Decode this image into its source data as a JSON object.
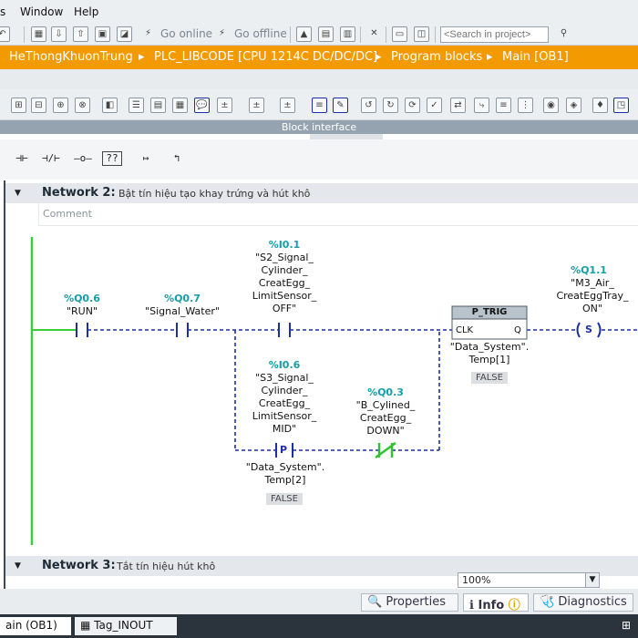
{
  "menu": {
    "items": [
      "s",
      "Window",
      "Help"
    ]
  },
  "toolbar": {
    "go_online": "Go online",
    "go_offline": "Go offline",
    "search_placeholder": "<Search in project>"
  },
  "breadcrumb": [
    "HeThongKhuonTrung",
    "PLC_LIBCODE [CPU 1214C DC/DC/DC]",
    "Program blocks",
    "Main [OB1]"
  ],
  "block_interface": {
    "title": "Block interface"
  },
  "favorites": [
    {
      "icon": "normally-open-contact-icon",
      "glyph": "⊣⊢"
    },
    {
      "icon": "normally-closed-contact-icon",
      "glyph": "⊣/⊢"
    },
    {
      "icon": "coil-icon",
      "glyph": "–o–"
    },
    {
      "icon": "empty-box-icon",
      "glyph": "??"
    },
    {
      "icon": "open-branch-icon",
      "glyph": "↦"
    },
    {
      "icon": "close-branch-icon",
      "glyph": "↰"
    }
  ],
  "network2": {
    "label": "Network 2:",
    "title": "Bật tín hiệu tạo khay trứng và hút khô",
    "comment": "Comment",
    "run": {
      "address": "%Q0.6",
      "tag": "\"RUN\""
    },
    "signal_water": {
      "address": "%Q0.7",
      "tag": "\"Signal_Water\""
    },
    "s2": {
      "address": "%I0.1",
      "tag": [
        "\"S2_Signal_",
        "Cylinder_",
        "CreatEgg_",
        "LimitSensor_",
        "OFF\""
      ]
    },
    "s3": {
      "address": "%I0.6",
      "tag": [
        "\"S3_Signal_",
        "Cylinder_",
        "CreatEgg_",
        "LimitSensor_",
        "MID\""
      ]
    },
    "p_edge": {
      "letter": "P",
      "operand": [
        "\"Data_System\".",
        "Temp[2]"
      ],
      "value": "FALSE"
    },
    "b_cylined": {
      "address": "%Q0.3",
      "tag": [
        "\"B_Cylined_",
        "CreatEgg_",
        "DOWN\""
      ]
    },
    "p_trig": {
      "title": "P_TRIG",
      "clk": "CLK",
      "q": "Q",
      "operand": [
        "\"Data_System\".",
        "Temp[1]"
      ],
      "value": "FALSE"
    },
    "coil": {
      "address": "%Q1.1",
      "tag": [
        "\"M3_Air_",
        "CreatEggTray_",
        "ON\""
      ],
      "letter": "S"
    }
  },
  "network3": {
    "label": "Network 3:",
    "title": "Tắt tín hiệu hút khô"
  },
  "zoom": "100%",
  "status_tabs": {
    "properties": "Properties",
    "info": "Info",
    "diagnostics": "Diagnostics"
  },
  "taskbar": {
    "main": "ain (OB1)",
    "tag_inout": "Tag_INOUT"
  },
  "colors": {
    "accent": "#f39a00",
    "wire": "#1c2fa8",
    "powerrail": "#3ccc3c",
    "address": "#169da8",
    "closed_contact": "#2ec42e"
  }
}
